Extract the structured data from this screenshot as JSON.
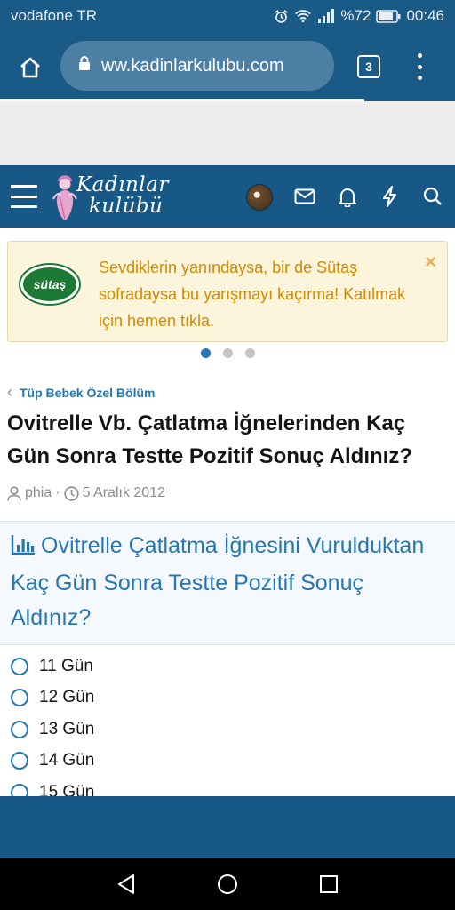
{
  "status_bar": {
    "carrier": "vodafone TR",
    "battery": "%72",
    "time": "00:46"
  },
  "browser": {
    "url": "ww.kadinlarkulubu.com",
    "tab_count": "3",
    "load_progress": 0.8
  },
  "site": {
    "logo_line1": "Kadınlar",
    "logo_line2": "kulübü"
  },
  "notice": {
    "sponsor_logo_text": "sütaş",
    "text": "Sevdiklerin yanındaysa, bir de Sütaş sofradaysa bu yarışmayı kaçırma! Katılmak için hemen tıkla.",
    "close_label": "×"
  },
  "carousel": {
    "count": 3,
    "active": 0
  },
  "thread": {
    "breadcrumb": "Tüp Bebek Özel Bölüm",
    "title": "Ovitrelle Vb. Çatlatma İğnelerinden Kaç Gün Sonra Testte Pozitif Sonuç Aldınız?",
    "author": "phia",
    "separator": "·",
    "date": "5 Aralık 2012"
  },
  "poll": {
    "question": "Ovitrelle Çatlatma İğnesini Vurulduktan Kaç Gün Sonra Testte Pozitif Sonuç Aldınız?",
    "options": [
      "11 Gün",
      "12 Gün",
      "13 Gün",
      "14 Gün",
      "15 Gün"
    ]
  },
  "colors": {
    "brand_blue": "#185886",
    "link_blue": "#2577b1",
    "notice_text": "#d48a00",
    "notice_bg": "#fdf4dc"
  },
  "icons": [
    "wifi-icon",
    "signal-icon",
    "alarm-icon",
    "battery-icon",
    "home-icon",
    "lock-icon",
    "tabs-icon",
    "overflow-menu-icon",
    "hamburger-icon",
    "mail-icon",
    "bell-icon",
    "bolt-icon",
    "search-icon",
    "user-icon",
    "clock-icon",
    "bar-chart-icon",
    "back-icon",
    "home-circle-icon",
    "recents-icon"
  ]
}
